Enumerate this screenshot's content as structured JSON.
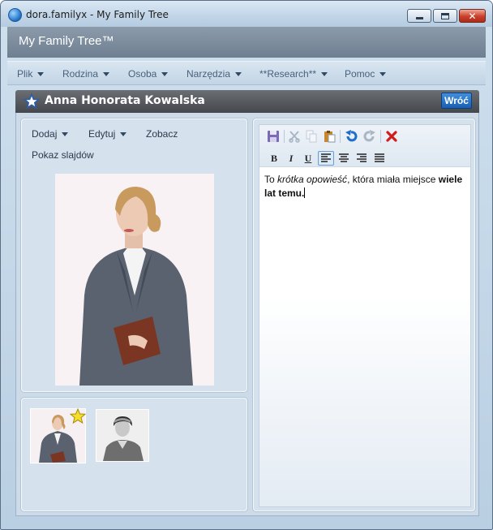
{
  "window": {
    "title": "dora.familyx - My Family Tree"
  },
  "app": {
    "title": "My Family Tree™"
  },
  "menu": {
    "items": [
      {
        "label": "Plik"
      },
      {
        "label": "Rodzina"
      },
      {
        "label": "Osoba"
      },
      {
        "label": "Narzędzia"
      },
      {
        "label": "**Research**"
      },
      {
        "label": "Pomoc"
      }
    ]
  },
  "person": {
    "name": "Anna Honorata Kowalska",
    "back_label": "Wróć"
  },
  "photo_panel": {
    "menu": [
      {
        "label": "Dodaj",
        "dropdown": true
      },
      {
        "label": "Edytuj",
        "dropdown": true
      },
      {
        "label": "Zobacz",
        "dropdown": false
      },
      {
        "label": "Pokaz slajdów",
        "dropdown": false
      }
    ]
  },
  "editor": {
    "toolbar_icons": [
      "save-icon",
      "cut-icon",
      "copy-icon",
      "paste-icon",
      "undo-icon",
      "redo-icon",
      "delete-icon"
    ],
    "format": {
      "bold": "B",
      "italic": "I",
      "underline": "U",
      "selected_alignment": "align-left"
    },
    "text": {
      "part1": "To ",
      "part2_italic": "krótka opowieść",
      "part3": ", która miała miejsce ",
      "part4_bold": "wiele lat temu."
    }
  },
  "colors": {
    "accent": "#1b5fb0",
    "header_bar": "#44484d",
    "delete": "#d11c1c"
  }
}
